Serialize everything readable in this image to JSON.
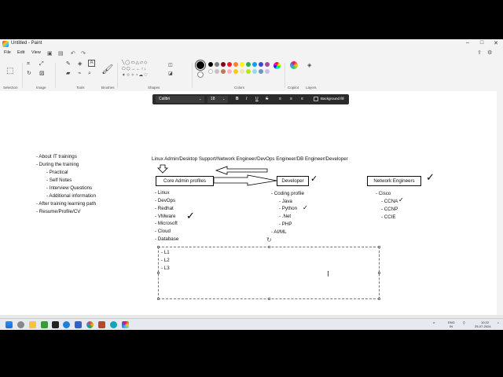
{
  "window": {
    "title": "Untitled - Paint",
    "minimize_icon": "minimize-icon",
    "maximize_icon": "maximize-icon",
    "close_icon": "close-icon"
  },
  "menu": {
    "file": "File",
    "edit": "Edit",
    "view": "View"
  },
  "ribbon": {
    "groups": [
      "Selection",
      "Image",
      "Tools",
      "Brushes",
      "Shapes",
      "Colors",
      "Copilot",
      "Layers"
    ],
    "colors": [
      "#000000",
      "#7f7f7f",
      "#880015",
      "#ed1c24",
      "#ff7f27",
      "#fff200",
      "#22b14c",
      "#00a2e8",
      "#3f48cc",
      "#a349a4",
      "#ffffff",
      "#c3c3c3",
      "#b97a57",
      "#ffaec9",
      "#ffc90e",
      "#efe4b0",
      "#b5e61d",
      "#99d9ea",
      "#7092be",
      "#c8bfe7"
    ]
  },
  "textbar": {
    "font": "Calibri",
    "size": "18",
    "bold": "B",
    "italic": "I",
    "underline": "U",
    "strike": "S",
    "background_fill": "Background fill"
  },
  "canvas": {
    "left_list": [
      "- About IT trainings",
      "- During the training",
      "- Practical",
      "- Self Notes",
      "- Interview Questions",
      "- Additional information",
      "- After training learning path",
      "- Resume/Profile/CV"
    ],
    "header": "Linux Admin/Desktop Support/Network Engineer/DevOps Engineer/DB Engineer/Developer",
    "box_core": "Core Admin profiles",
    "box_dev": "Developer",
    "box_net": "Network Engineers",
    "core_list": [
      "- Linux",
      "- DevOps",
      "- Redhat",
      "- VMware",
      "- Microsoft",
      "- Cloud",
      "- Database"
    ],
    "dev_list": [
      "- Coding profile",
      "- Java",
      "- Python",
      "- .Net",
      "- PHP",
      "- AI/ML"
    ],
    "net_list": [
      "- Cisco",
      "- CCNA",
      "- CCNP",
      "- CCIE"
    ],
    "sel_list": [
      "- L1",
      "- L2",
      "- L3"
    ],
    "tick": "✓"
  },
  "taskbar": {
    "lang": "ENG",
    "region": "IN",
    "time": "10:22",
    "date": "25-07-2024"
  }
}
